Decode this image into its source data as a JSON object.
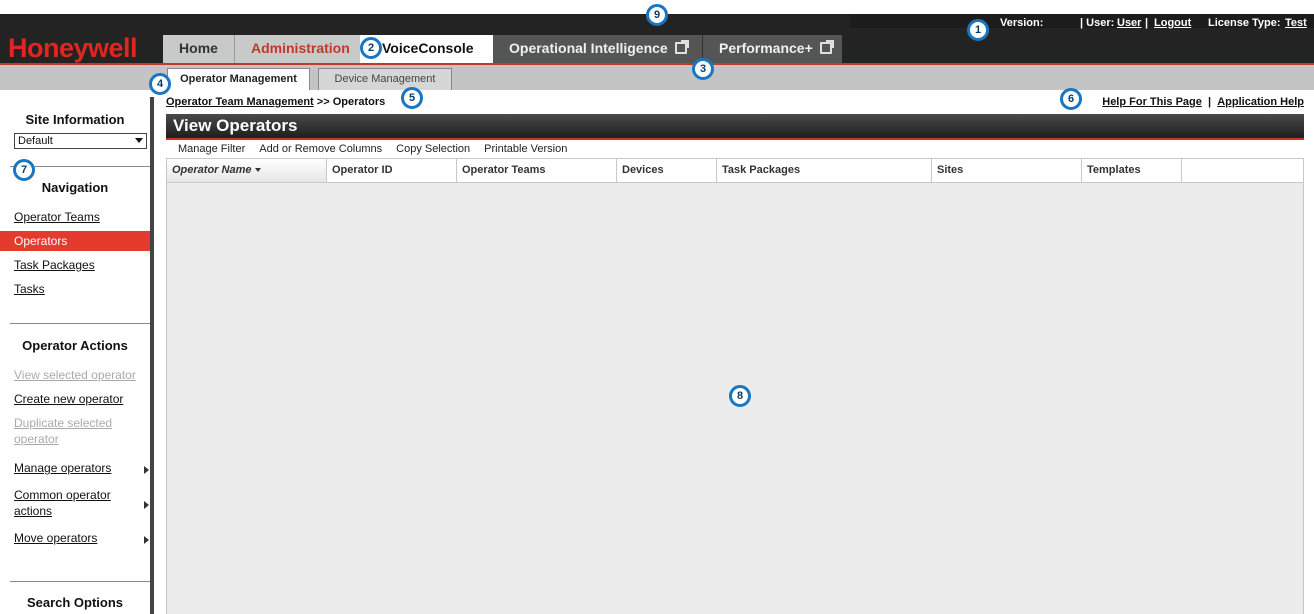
{
  "header": {
    "logo": "Honeywell",
    "status": {
      "version_label": "Version:",
      "user_label": "| User:",
      "user_link": "User",
      "separator": "|",
      "logout": "Logout",
      "license_label": "License Type:",
      "license_link": "Test"
    },
    "tabs": [
      "Home",
      "Administration",
      "VoiceConsole",
      "Operational Intelligence",
      "Performance+"
    ]
  },
  "subtabs": [
    "Operator Management",
    "Device Management"
  ],
  "sidebar": {
    "site_title": "Site Information",
    "site_value": "Default",
    "navigation_title": "Navigation",
    "nav_items": [
      "Operator Teams",
      "Operators",
      "Task Packages",
      "Tasks"
    ],
    "actions_title": "Operator Actions",
    "actions": [
      "View selected operator",
      "Create new operator",
      "Duplicate selected operator",
      "Manage operators",
      "Common operator actions",
      "Move operators"
    ],
    "search_title": "Search Options"
  },
  "main": {
    "breadcrumb_link": "Operator Team Management",
    "breadcrumb_current": ">> Operators",
    "help_page": "Help For This Page",
    "help_sep": "|",
    "app_help": "Application Help",
    "panel_title": "View Operators",
    "toolbar": [
      "Manage Filter",
      "Add or Remove Columns",
      "Copy Selection",
      "Printable Version"
    ],
    "columns": [
      "Operator Name",
      "Operator ID",
      "Operator Teams",
      "Devices",
      "Task Packages",
      "Sites",
      "Templates"
    ]
  },
  "callouts": [
    "1",
    "2",
    "3",
    "4",
    "5",
    "6",
    "7",
    "8",
    "9"
  ],
  "colors": {
    "brand_red": "#e0261f",
    "accent_red": "#c0392b",
    "callout_blue": "#1976c2"
  }
}
